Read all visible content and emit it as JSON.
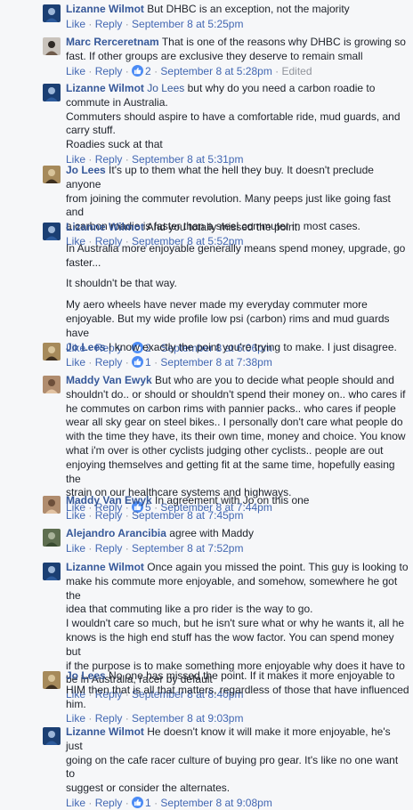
{
  "comments": [
    {
      "author": "Lizanne Wilmot",
      "lines": [
        "But DHBC is an exception, not the majority"
      ],
      "like": "Like",
      "reply": "Reply",
      "reactions": "",
      "time": "September 8 at 5:25pm",
      "edited": ""
    },
    {
      "author": "Marc Rerceretnam",
      "lines": [
        "That is one of the reasons why DHBC is growing so",
        "fast. If other groups are exclusive they deserve to remain small"
      ],
      "like": "Like",
      "reply": "Reply",
      "reactions": "2",
      "time": "September 8 at 5:28pm",
      "edited": "Edited"
    },
    {
      "author": "Lizanne Wilmot",
      "mention": "Jo Lees",
      "lines": [
        "but why do you need a carbon roadie to",
        "commute in Australia.",
        "Commuters should aspire to have a comfortable ride, mud guards, and",
        "carry stuff.",
        "Roadies suck at that"
      ],
      "like": "Like",
      "reply": "Reply",
      "reactions": "",
      "time": "September 8 at 5:31pm",
      "edited": ""
    },
    {
      "author": "Jo Lees",
      "lines": [
        "It's up to them what the hell they buy. It doesn't preclude anyone",
        "from joining the commuter revolution. Many peeps just like going fast and",
        "a carbon roadie is faster than a steel commuter in most cases."
      ],
      "like": "Like",
      "reply": "Reply",
      "reactions": "",
      "time": "September 8 at 5:52pm",
      "edited": ""
    },
    {
      "author": "Lizanne Wilmot",
      "lines": [
        "And you totally missed the point."
      ],
      "paragraphs": [
        [
          "In Australia more enjoyable generally means spend money, upgrade, go",
          "faster..."
        ],
        [
          "It shouldn't be that way."
        ],
        [
          "My aero wheels have never made my everyday commuter more",
          "enjoyable. But my wide profile low psi (carbon) rims and mud guards have"
        ]
      ],
      "like": "Like",
      "reply": "Reply",
      "reactions": "2",
      "time": "September 8 at 6:06pm",
      "edited": ""
    },
    {
      "author": "Jo Lees",
      "lines": [
        "I know exactly the point you're trying to make. I just disagree."
      ],
      "like": "Like",
      "reply": "Reply",
      "reactions": "1",
      "time": "September 8 at 7:38pm",
      "edited": ""
    },
    {
      "author": "Maddy Van Ewyk",
      "lines": [
        "But who are you to decide what people should and",
        "shouldn't do.. or should or shouldn't spend their money on.. who cares if",
        "he commutes on carbon rims with pannier packs.. who cares if people",
        "wear all sky gear on steel bikes.. I personally don't care what people do",
        "with the time they have, its their own time, money and choice. You know",
        "what i'm over is other cyclists judging other cyclists.. people are out",
        "enjoying themselves and getting fit at the same time, hopefully easing the",
        "strain on our healthcare systems and highways."
      ],
      "like": "Like",
      "reply": "Reply",
      "reactions": "5",
      "time": "September 8 at 7:44pm",
      "edited": ""
    },
    {
      "author": "Maddy Van Ewyk",
      "lines": [
        "In agreement with Jo on this one"
      ],
      "like": "Like",
      "reply": "Reply",
      "reactions": "",
      "time": "September 8 at 7:45pm",
      "edited": ""
    },
    {
      "author": "Alejandro Arancibia",
      "lines": [
        "agree with Maddy"
      ],
      "like": "Like",
      "reply": "Reply",
      "reactions": "",
      "time": "September 8 at 7:52pm",
      "edited": ""
    },
    {
      "author": "Lizanne Wilmot",
      "lines": [
        "Once again you missed the point. This guy is looking to",
        "make his commute more enjoyable, and somehow, somewhere he got the",
        "idea that commuting like a pro rider is the way to go.",
        "I wouldn't care so much, but he isn't sure what or why he wants it, all he",
        "knows is the high end stuff has the wow factor. You can spend money but",
        "if the purpose is to make something more enjoyable why does it have to",
        "be in Australia, racer by default"
      ],
      "like": "Like",
      "reply": "Reply",
      "reactions": "",
      "time": "September 8 at 8:40pm",
      "edited": ""
    },
    {
      "author": "Jo Lees",
      "lines": [
        "No one has missed the point. If it makes it more enjoyable to",
        "HIM then that is all that matters, regardless of those that have influenced",
        "him."
      ],
      "like": "Like",
      "reply": "Reply",
      "reactions": "",
      "time": "September 8 at 9:03pm",
      "edited": ""
    },
    {
      "author": "Lizanne Wilmot",
      "lines": [
        "He doesn't know it will make it more enjoyable, he's just",
        "going on the cafe racer culture of buying pro gear. It's like no one want to",
        "suggest or consider the alternates."
      ],
      "like": "Like",
      "reply": "Reply",
      "reactions": "1",
      "time": "September 8 at 9:08pm",
      "edited": ""
    }
  ],
  "colors": {
    "name": "#365899",
    "link": "#4267b2",
    "meta": "#90949c",
    "reaction": "#4b8bf5"
  }
}
